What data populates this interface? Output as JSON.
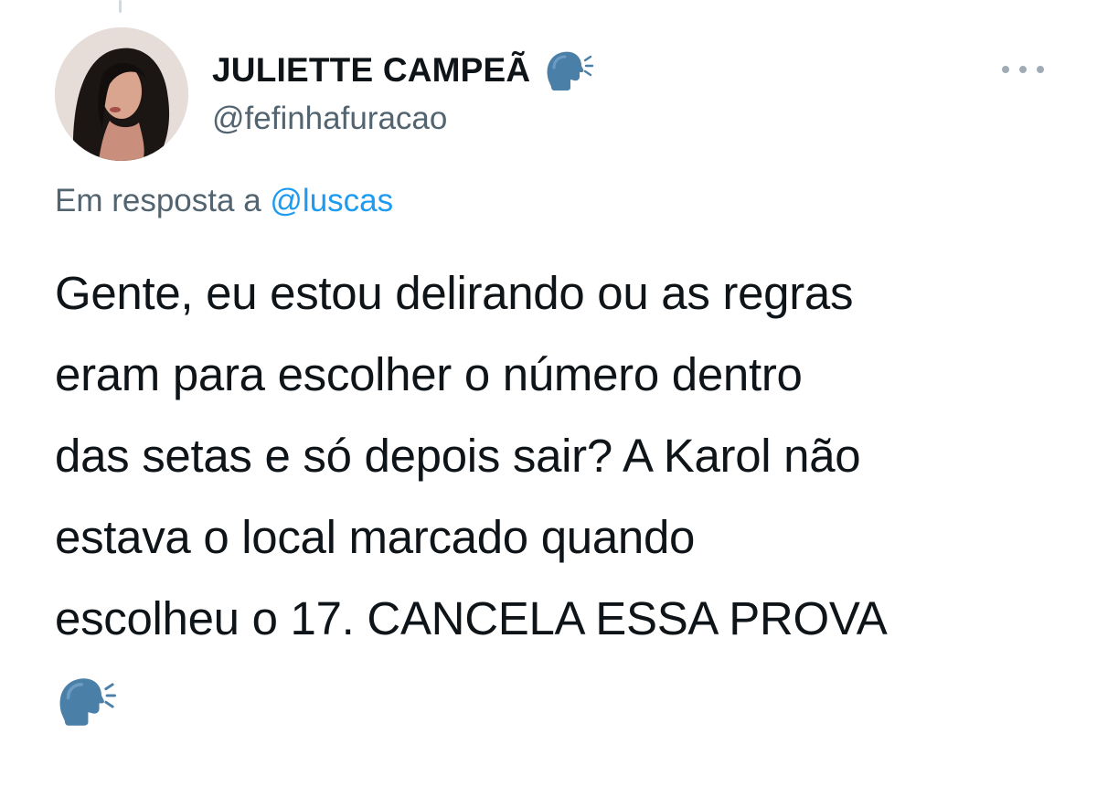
{
  "tweet": {
    "author": {
      "display_name": "JULIETTE CAMPEÃ",
      "name_emoji": "speaking-head-icon",
      "handle": "@fefinhafuracao",
      "avatar": "avatar"
    },
    "reply_to": {
      "prefix": "Em resposta a",
      "mention": "@luscas"
    },
    "text_lines": [
      "Gente, eu estou delirando ou as regras",
      "eram para escolher o número dentro",
      "das setas e só depois sair? A Karol não",
      "estava o local marcado quando",
      "escolheu o 17. CANCELA ESSA PROVA"
    ],
    "trailing_emoji": "speaking-head-icon",
    "more_button_icon": "more-options-icon"
  },
  "colors": {
    "text": "#0f1419",
    "secondary": "#536471",
    "link": "#1d9bf0",
    "emoji_blue": "#4a7fa8"
  }
}
